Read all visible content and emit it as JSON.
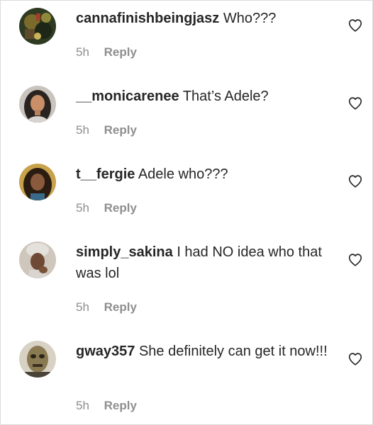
{
  "comments": [
    {
      "username": "cannafinishbeingjasz",
      "text": "Who???",
      "time": "5h",
      "reply_label": "Reply",
      "avatar_icon": "user-avatar-dark-collage",
      "like_icon": "heart-outline-icon"
    },
    {
      "username": "__monicarenee",
      "text": "That’s Adele?",
      "time": "5h",
      "reply_label": "Reply",
      "avatar_icon": "user-avatar-woman-portrait",
      "like_icon": "heart-outline-icon"
    },
    {
      "username": "t__fergie",
      "text": "Adele who???",
      "time": "5h",
      "reply_label": "Reply",
      "avatar_icon": "user-avatar-woman-portrait",
      "like_icon": "heart-outline-icon"
    },
    {
      "username": "simply_sakina",
      "text": "I had NO idea who that was lol",
      "time": "5h",
      "reply_label": "Reply",
      "avatar_icon": "user-avatar-woman-portrait",
      "like_icon": "heart-outline-icon"
    },
    {
      "username": "gway357",
      "text": "She definitely can get it now!!!",
      "time": "5h",
      "reply_label": "Reply",
      "avatar_icon": "user-avatar-masked-face",
      "like_icon": "heart-outline-icon"
    }
  ],
  "colors": {
    "primary_text": "#262626",
    "secondary_text": "#8e8e8e",
    "border": "#dbdbdb"
  }
}
